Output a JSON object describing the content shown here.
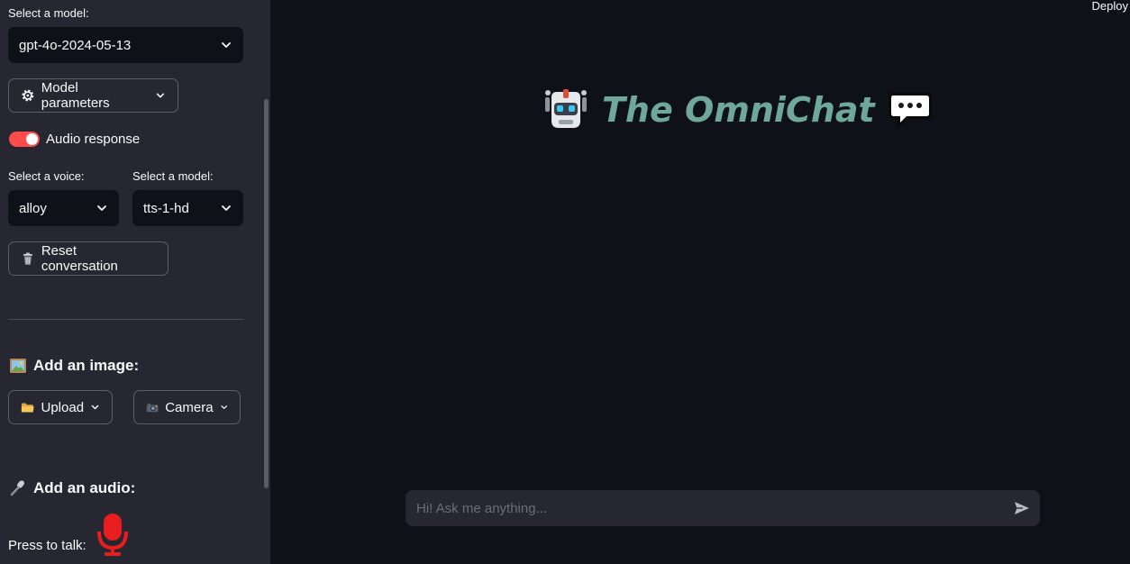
{
  "sidebar": {
    "model_label": "Select a model:",
    "model_value": "gpt-4o-2024-05-13",
    "model_params_label": "Model parameters",
    "audio_response_label": "Audio response",
    "audio_response_on": true,
    "voice_label": "Select a voice:",
    "voice_value": "alloy",
    "tts_model_label": "Select a model:",
    "tts_model_value": "tts-1-hd",
    "reset_label": "Reset conversation",
    "add_image_heading": "Add an image:",
    "upload_label": "Upload",
    "camera_label": "Camera",
    "add_audio_heading": "Add an audio:",
    "press_to_talk_label": "Press to talk:"
  },
  "header": {
    "deploy_label": "Deploy"
  },
  "main": {
    "title": "The OmniChat"
  },
  "chat": {
    "placeholder": "Hi! Ask me anything..."
  },
  "colors": {
    "accent": "#ff4b4b",
    "title": "#6fa898",
    "sidebar_bg": "#262730",
    "main_bg": "#0e1117"
  },
  "icons": {
    "model_params": "gear-icon",
    "reset": "trash-icon",
    "image": "picture-icon",
    "upload": "folder-icon",
    "camera": "camera-icon",
    "audio": "microphone-icon",
    "talk": "red-microphone-icon",
    "title_left": "robot-icon",
    "title_right": "speech-bubble-icon",
    "send": "send-icon"
  }
}
